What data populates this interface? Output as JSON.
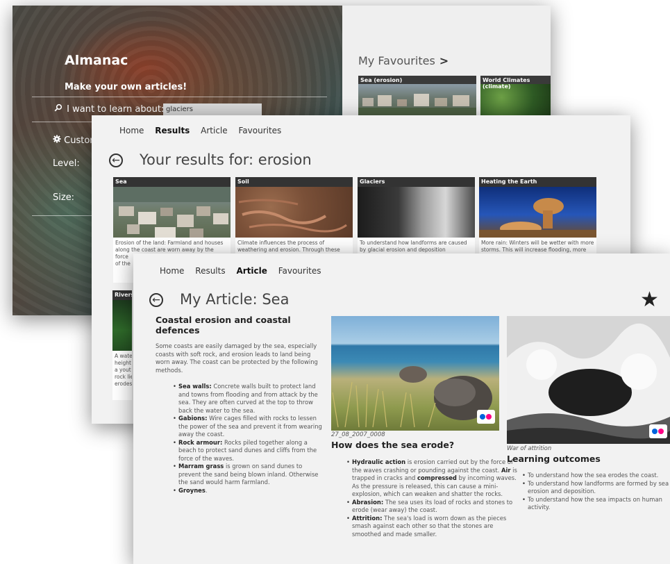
{
  "window1": {
    "title": "Almanac",
    "make_articles": "Make your own articles!",
    "learn_label": "I want to learn about:",
    "learn_value": "glaciers",
    "customise_label": "Custom",
    "level_label": "Level:",
    "size_label": "Size:",
    "favourites_title": "My Favourites",
    "favourites_chevron": ">",
    "favourites": [
      {
        "label": "Sea (erosion)"
      },
      {
        "label": "World Climates (climate)"
      }
    ]
  },
  "window2": {
    "nav": [
      "Home",
      "Results",
      "Article",
      "Favourites"
    ],
    "nav_active": "Results",
    "heading": "Your results for: erosion",
    "results": [
      {
        "label": "Sea",
        "desc1": "Erosion of the land: Farmland and houses",
        "desc2": "along the coast are worn away by the force",
        "desc3": "of the"
      },
      {
        "label": "Soil",
        "desc1": "Climate influences the process of",
        "desc2": "weathering and erosion. Through these",
        "desc3": ""
      },
      {
        "label": "Glaciers",
        "desc1": "To understand how landforms are caused",
        "desc2": "by glacial erosion and deposition",
        "desc3": ""
      },
      {
        "label": "Heating the Earth",
        "desc1": "More rain: Winters will be wetter with more",
        "desc2": "storms. This will increase flooding, more",
        "desc3": ""
      }
    ],
    "rivers": {
      "label": "Rivers",
      "desc": [
        "A wate",
        "height",
        "a yout",
        "rock lie",
        "erodes"
      ]
    }
  },
  "window3": {
    "nav": [
      "Home",
      "Results",
      "Article",
      "Favourites"
    ],
    "nav_active": "Article",
    "heading": "My Article: Sea",
    "col1": {
      "title": "Coastal erosion and coastal defences",
      "intro": "Some coasts are easily damaged by the sea, especially coasts with soft rock, and erosion leads to land being worn away. The coast can be protected by the following methods.",
      "items": [
        {
          "bold": "Sea walls:",
          "text": " Concrete walls built to protect land and towns from flooding and from attack by the sea. They are often curved at the top to throw back the water to the sea."
        },
        {
          "bold": "Gabions:",
          "text": " Wire cages filled with rocks to lessen the power of the sea and prevent it from wearing away the coast."
        },
        {
          "bold": "Rock armour:",
          "text": " Rocks piled together along a beach to protect sand dunes and cliffs from the force of the waves."
        },
        {
          "bold": "Marram grass",
          "text": " is grown on sand dunes to prevent the sand being blown inland. Otherwise the sand would harm farmland."
        },
        {
          "bold": "Groynes",
          "text": "."
        }
      ]
    },
    "col2": {
      "caption": "27_08_2007_0008",
      "title": "How does the sea erode?",
      "items": [
        {
          "html_parts": [
            [
              "b",
              "Hydraulic action"
            ],
            [
              "t",
              " is erosion carried out by the force of the waves crashing or pounding against the coast. "
            ],
            [
              "b",
              "Air"
            ],
            [
              "t",
              " is trapped in cracks and "
            ],
            [
              "b",
              "compressed"
            ],
            [
              "t",
              " by incoming waves. As the pressure is released, this can cause a mini-explosion, which can weaken and shatter the rocks."
            ]
          ]
        },
        {
          "html_parts": [
            [
              "b",
              "Abrasion:"
            ],
            [
              "t",
              " The sea uses its load of rocks and stones to erode (wear away) the coast."
            ]
          ]
        },
        {
          "html_parts": [
            [
              "b",
              "Attrition:"
            ],
            [
              "t",
              " The sea's load is worn down as the pieces smash against each other so that the stones are smoothed and made smaller."
            ]
          ]
        }
      ]
    },
    "col3": {
      "caption": "War of attrition",
      "title": "Learning outcomes",
      "items": [
        "To understand how the sea erodes the coast.",
        "To understand how landforms are formed by sea erosion and deposition.",
        "To understand how the sea impacts on human activity."
      ]
    },
    "star_icon": "★"
  },
  "icons": {
    "search": "⚲",
    "gear": "✿",
    "back": "←",
    "chevron": "›"
  }
}
